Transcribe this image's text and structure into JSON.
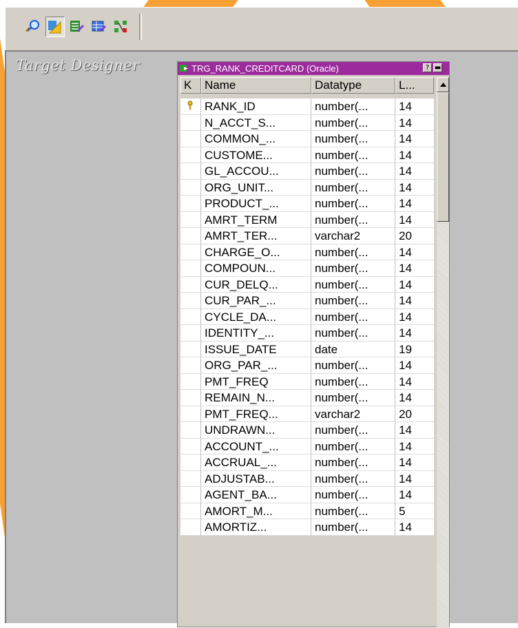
{
  "toolbar": {
    "icons": [
      "search-layer-icon",
      "target-designer-icon",
      "edit-table-icon",
      "grid-table-icon",
      "link-icon"
    ],
    "pressed_index": 1
  },
  "workspace": {
    "title": "Target Designer"
  },
  "table_window": {
    "title": "TRG_RANK_CREDITCARD (Oracle)",
    "help_label": "?",
    "minimize_label": "▬",
    "columns": [
      "K",
      "Name",
      "Datatype",
      "L..."
    ],
    "rows": [
      {
        "key": true,
        "name": "RANK_ID",
        "type": "number(...",
        "len": "14"
      },
      {
        "key": false,
        "name": "N_ACCT_S...",
        "type": "number(...",
        "len": "14"
      },
      {
        "key": false,
        "name": "COMMON_...",
        "type": "number(...",
        "len": "14"
      },
      {
        "key": false,
        "name": "CUSTOME...",
        "type": "number(...",
        "len": "14"
      },
      {
        "key": false,
        "name": "GL_ACCOU...",
        "type": "number(...",
        "len": "14"
      },
      {
        "key": false,
        "name": "ORG_UNIT...",
        "type": "number(...",
        "len": "14"
      },
      {
        "key": false,
        "name": "PRODUCT_...",
        "type": "number(...",
        "len": "14"
      },
      {
        "key": false,
        "name": "AMRT_TERM",
        "type": "number(...",
        "len": "14"
      },
      {
        "key": false,
        "name": "AMRT_TER...",
        "type": "varchar2",
        "len": "20"
      },
      {
        "key": false,
        "name": "CHARGE_O...",
        "type": "number(...",
        "len": "14"
      },
      {
        "key": false,
        "name": "COMPOUN...",
        "type": "number(...",
        "len": "14"
      },
      {
        "key": false,
        "name": "CUR_DELQ...",
        "type": "number(...",
        "len": "14"
      },
      {
        "key": false,
        "name": "CUR_PAR_...",
        "type": "number(...",
        "len": "14"
      },
      {
        "key": false,
        "name": "CYCLE_DA...",
        "type": "number(...",
        "len": "14"
      },
      {
        "key": false,
        "name": "IDENTITY_...",
        "type": "number(...",
        "len": "14"
      },
      {
        "key": false,
        "name": "ISSUE_DATE",
        "type": "date",
        "len": "19"
      },
      {
        "key": false,
        "name": "ORG_PAR_...",
        "type": "number(...",
        "len": "14"
      },
      {
        "key": false,
        "name": "PMT_FREQ",
        "type": "number(...",
        "len": "14"
      },
      {
        "key": false,
        "name": "REMAIN_N...",
        "type": "number(...",
        "len": "14"
      },
      {
        "key": false,
        "name": "PMT_FREQ...",
        "type": "varchar2",
        "len": "20"
      },
      {
        "key": false,
        "name": "UNDRAWN...",
        "type": "number(...",
        "len": "14"
      },
      {
        "key": false,
        "name": "ACCOUNT_...",
        "type": "number(...",
        "len": "14"
      },
      {
        "key": false,
        "name": "ACCRUAL_...",
        "type": "number(...",
        "len": "14"
      },
      {
        "key": false,
        "name": "ADJUSTAB...",
        "type": "number(...",
        "len": "14"
      },
      {
        "key": false,
        "name": "AGENT_BA...",
        "type": "number(...",
        "len": "14"
      },
      {
        "key": false,
        "name": "AMORT_M...",
        "type": "number(...",
        "len": "5"
      },
      {
        "key": false,
        "name": "AMORTIZ...",
        "type": "number(...",
        "len": "14"
      }
    ]
  },
  "colors": {
    "title_bar": "#9c2b9c",
    "background_accent": "#f7a134",
    "workspace": "#c0c0c0"
  }
}
